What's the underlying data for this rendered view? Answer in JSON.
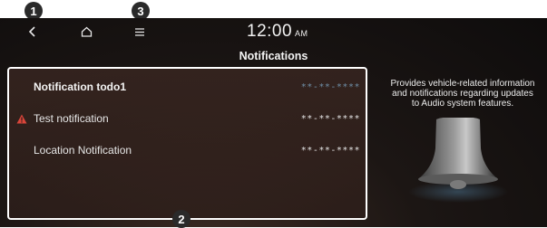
{
  "callouts": [
    "1",
    "2",
    "3"
  ],
  "topbar": {
    "back_icon": "back-arrow-icon",
    "home_icon": "home-icon",
    "menu_icon": "menu-icon",
    "time": "12:00",
    "ampm": "AM"
  },
  "page_title": "Notifications",
  "notifications": [
    {
      "title": "Notification todo1",
      "date": "**-**-****",
      "bold": true,
      "warning": false,
      "date_color": "#6f8fa8"
    },
    {
      "title": "Test notification",
      "date": "**-**-****",
      "bold": false,
      "warning": true,
      "date_color": "#e4e4e4"
    },
    {
      "title": "Location Notification",
      "date": "**-**-****",
      "bold": false,
      "warning": false,
      "date_color": "#e4e4e4"
    }
  ],
  "info_text": "Provides vehicle-related information and notifications regarding updates to Audio system features.",
  "colors": {
    "warning": "#d9453a",
    "callout": "#2a2a2a",
    "highlight_border": "#ffffff"
  }
}
